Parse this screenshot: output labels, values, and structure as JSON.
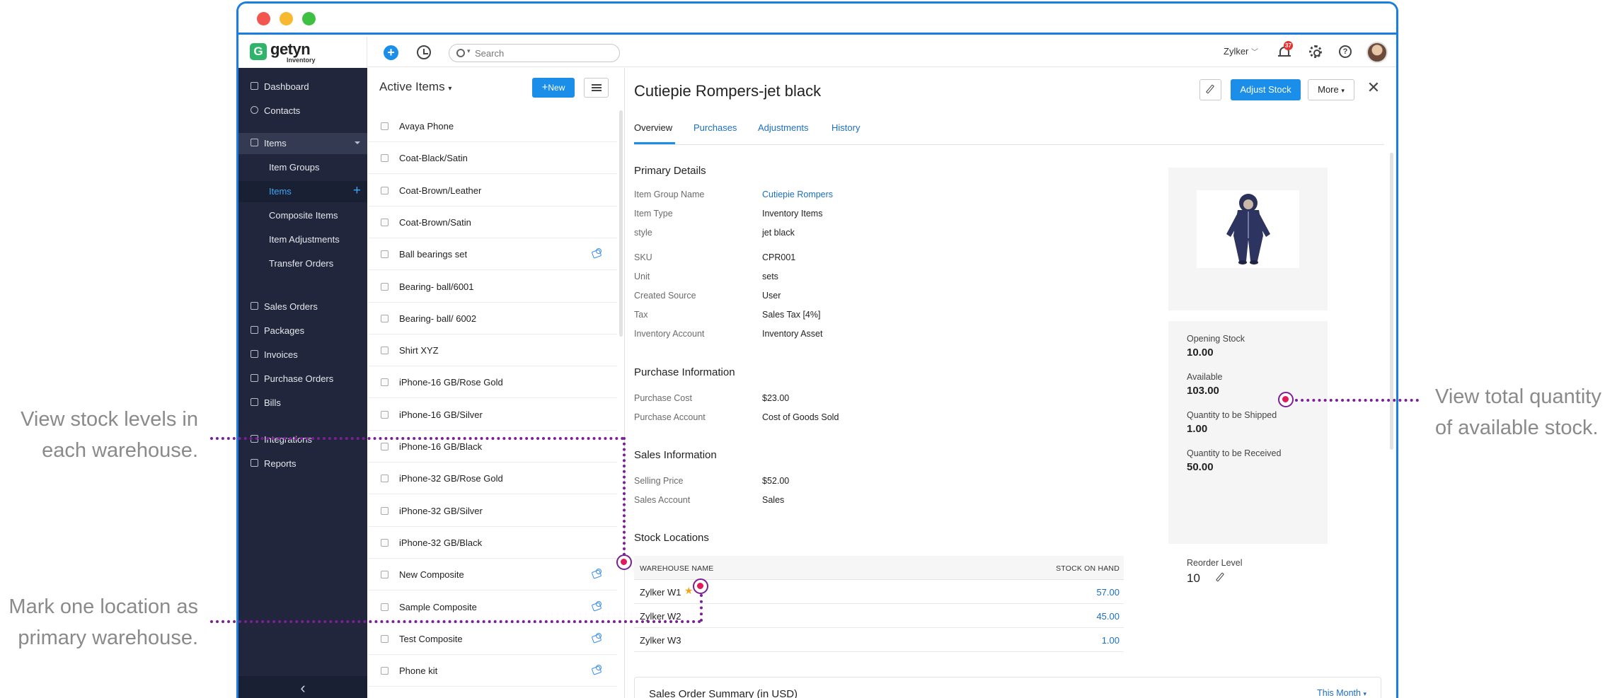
{
  "topbar": {
    "brand_name": "getyn",
    "brand_sub": "Inventory",
    "search_placeholder": "Search",
    "org_name": "Zylker",
    "notification_count": "37"
  },
  "sidebar": {
    "items": [
      {
        "label": "Dashboard",
        "icon": "home-icon"
      },
      {
        "label": "Contacts",
        "icon": "user-icon"
      },
      {
        "label": "Items",
        "icon": "basket-icon"
      },
      {
        "label": "Sales Orders",
        "icon": "cart-icon"
      },
      {
        "label": "Packages",
        "icon": "package-icon"
      },
      {
        "label": "Invoices",
        "icon": "invoice-icon"
      },
      {
        "label": "Purchase Orders",
        "icon": "bag-icon"
      },
      {
        "label": "Bills",
        "icon": "bill-icon"
      },
      {
        "label": "Integrations",
        "icon": "plug-icon"
      },
      {
        "label": "Reports",
        "icon": "chart-icon"
      }
    ],
    "sub_items": [
      "Item Groups",
      "Items",
      "Composite Items",
      "Item Adjustments",
      "Transfer Orders"
    ],
    "selected_sub": "Items"
  },
  "list": {
    "title": "Active Items",
    "new_button": "New",
    "rows": [
      {
        "name": "Avaya Phone",
        "composite": false
      },
      {
        "name": "Coat-Black/Satin",
        "composite": false
      },
      {
        "name": "Coat-Brown/Leather",
        "composite": false
      },
      {
        "name": "Coat-Brown/Satin",
        "composite": false
      },
      {
        "name": "Ball bearings set",
        "composite": true
      },
      {
        "name": "Bearing- ball/6001",
        "composite": false
      },
      {
        "name": "Bearing- ball/ 6002",
        "composite": false
      },
      {
        "name": "Shirt XYZ",
        "composite": false
      },
      {
        "name": "iPhone-16 GB/Rose Gold",
        "composite": false
      },
      {
        "name": "iPhone-16 GB/Silver",
        "composite": false
      },
      {
        "name": "iPhone-16 GB/Black",
        "composite": false
      },
      {
        "name": "iPhone-32 GB/Rose Gold",
        "composite": false
      },
      {
        "name": "iPhone-32 GB/Silver",
        "composite": false
      },
      {
        "name": "iPhone-32 GB/Black",
        "composite": false
      },
      {
        "name": "New Composite",
        "composite": true
      },
      {
        "name": "Sample Composite",
        "composite": true
      },
      {
        "name": "Test Composite",
        "composite": true
      },
      {
        "name": "Phone kit",
        "composite": true
      }
    ]
  },
  "detail": {
    "title": "Cutiepie Rompers-jet black",
    "adjust_button": "Adjust Stock",
    "more_button": "More",
    "tabs": [
      "Overview",
      "Purchases",
      "Adjustments",
      "History"
    ],
    "active_tab": "Overview",
    "primary": {
      "heading": "Primary Details",
      "fields": [
        {
          "k": "Item Group Name",
          "v": "Cutiepie Rompers",
          "link": true
        },
        {
          "k": "Item Type",
          "v": "Inventory Items"
        },
        {
          "k": "style",
          "v": "jet black"
        },
        {
          "k": "SKU",
          "v": "CPR001"
        },
        {
          "k": "Unit",
          "v": "sets"
        },
        {
          "k": "Created Source",
          "v": "User"
        },
        {
          "k": "Tax",
          "v": "Sales Tax [4%]"
        },
        {
          "k": "Inventory Account",
          "v": "Inventory Asset"
        }
      ]
    },
    "purchase": {
      "heading": "Purchase Information",
      "fields": [
        {
          "k": "Purchase Cost",
          "v": "$23.00"
        },
        {
          "k": "Purchase Account",
          "v": "Cost of Goods Sold"
        }
      ]
    },
    "sales": {
      "heading": "Sales Information",
      "fields": [
        {
          "k": "Selling Price",
          "v": "$52.00"
        },
        {
          "k": "Sales Account",
          "v": "Sales"
        }
      ]
    },
    "locations": {
      "heading": "Stock Locations",
      "col_name": "WAREHOUSE NAME",
      "col_stock": "STOCK ON HAND",
      "rows": [
        {
          "name": "Zylker W1",
          "stock": "57.00",
          "primary": true
        },
        {
          "name": "Zylker W2",
          "stock": "45.00",
          "primary": false
        },
        {
          "name": "Zylker W3",
          "stock": "1.00",
          "primary": false
        }
      ]
    },
    "stock": [
      {
        "label": "Opening Stock",
        "value": "10.00"
      },
      {
        "label": "Available",
        "value": "103.00"
      },
      {
        "label": "Quantity to be Shipped",
        "value": "1.00"
      },
      {
        "label": "Quantity to be Received",
        "value": "50.00"
      }
    ],
    "reorder": {
      "label": "Reorder Level",
      "value": "10"
    },
    "summary": {
      "title": "Sales Order Summary (in USD)",
      "range": "This Month"
    }
  },
  "callouts": {
    "warehouse": [
      "View stock levels in",
      "each warehouse."
    ],
    "primary": [
      "Mark one location as",
      "primary warehouse."
    ],
    "available": [
      "View total quantity",
      "of available stock."
    ]
  },
  "colors": {
    "accent": "#1a8ee8",
    "sidebar": "#21263c",
    "annotation": "#7b1f98",
    "marker": "#e2195b"
  }
}
